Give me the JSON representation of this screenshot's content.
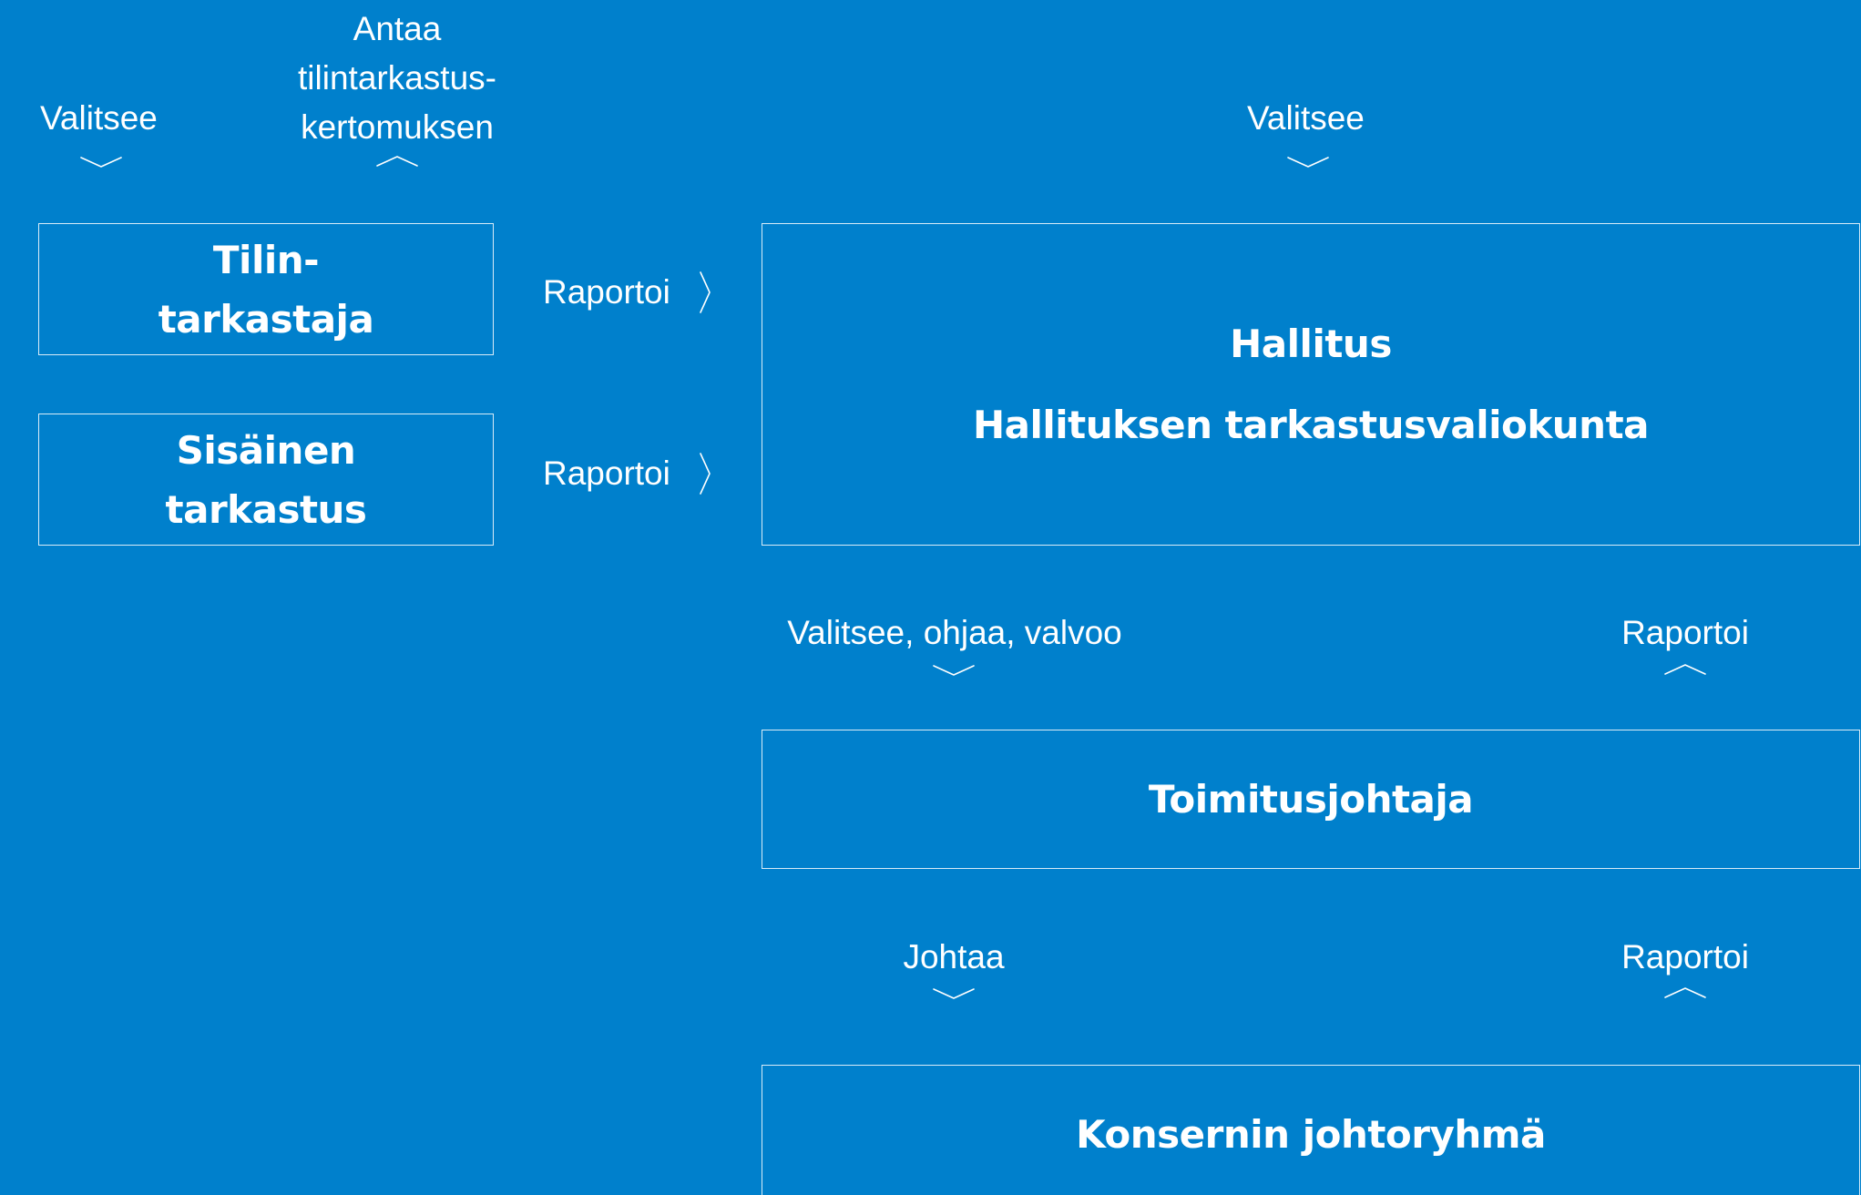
{
  "theme": {
    "background": "#0080cc",
    "foreground": "#ffffff"
  },
  "boxes": {
    "auditor": {
      "line1": "Tilin-",
      "line2": "tarkastaja"
    },
    "internal_audit": {
      "line1": "Sisäinen",
      "line2": "tarkastus"
    },
    "board": {
      "line1": "Hallitus",
      "line2": "Hallituksen tarkastusvaliokunta"
    },
    "ceo": {
      "line1": "Toimitusjohtaja"
    },
    "group_management": {
      "line1": "Konsernin johtoryhmä"
    }
  },
  "labels": {
    "auditor_selects": "Valitsee",
    "audit_report_1": "Antaa",
    "audit_report_2": "tilintarkastus-",
    "audit_report_3": "kertomuksen",
    "board_selects": "Valitsee",
    "auditor_reports": "Raportoi",
    "internal_reports": "Raportoi",
    "board_directs": "Valitsee, ohjaa, valvoo",
    "ceo_reports": "Raportoi",
    "ceo_leads": "Johtaa",
    "management_reports": "Raportoi"
  },
  "icons": {
    "down": "chevron-down-icon",
    "up": "chevron-up-icon",
    "right": "chevron-right-icon"
  }
}
